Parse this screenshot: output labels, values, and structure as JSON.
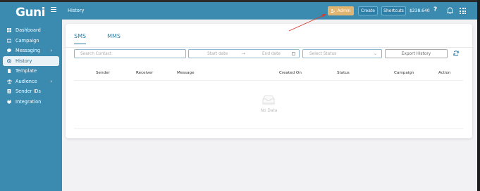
{
  "brand": {
    "logo_text": "Guni"
  },
  "header": {
    "title": "History",
    "admin_label": "Admin",
    "create_label": "Create",
    "shortcuts_label": "Shortcuts",
    "balance": "$238.640",
    "help_label": "?"
  },
  "sidebar": {
    "items": [
      {
        "label": "Dashboard",
        "icon": "dashboard-icon"
      },
      {
        "label": "Campaign",
        "icon": "campaign-icon"
      },
      {
        "label": "Messaging",
        "icon": "messaging-icon",
        "has_children": true
      },
      {
        "label": "History",
        "icon": "history-icon",
        "active": true
      },
      {
        "label": "Template",
        "icon": "template-icon"
      },
      {
        "label": "Audience",
        "icon": "audience-icon",
        "has_children": true
      },
      {
        "label": "Sender IDs",
        "icon": "sender-id-icon"
      },
      {
        "label": "Integration",
        "icon": "integration-icon"
      }
    ]
  },
  "tabs": [
    {
      "label": "SMS",
      "active": true
    },
    {
      "label": "MMS",
      "active": false
    }
  ],
  "filters": {
    "search_placeholder": "Search Contact",
    "start_date_placeholder": "Start date",
    "end_date_placeholder": "End date",
    "status_placeholder": "Select Status",
    "export_label": "Export History"
  },
  "table": {
    "columns": [
      "Sender",
      "Receiver",
      "Message",
      "Created On",
      "Status",
      "Campaign",
      "Action"
    ],
    "empty_text": "No Data"
  },
  "colors": {
    "sidebar_bg": "#3b8ab0",
    "admin_button": "#e0b571",
    "accent": "#2e7fa8",
    "annotation_arrow": "#d9372b"
  }
}
